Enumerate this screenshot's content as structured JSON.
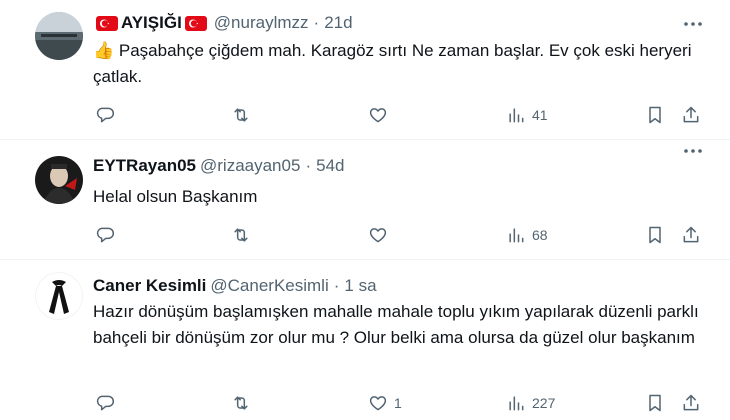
{
  "tweets": [
    {
      "display_name": "AYIŞIĞI",
      "handle": "@nuraylmzz",
      "separator": "·",
      "time": "21d",
      "text": "👍 Paşabahçe çiğdem mah. Karagöz sırtı  Ne zaman başlar. Ev çok eski heryeri çatlak.",
      "reply_count": "",
      "retweet_count": "",
      "like_count": "",
      "views": "41"
    },
    {
      "display_name": "EYTRayan05",
      "handle": "@rizaayan05",
      "separator": "·",
      "time": "54d",
      "text": "Helal olsun Başkanım",
      "reply_count": "",
      "retweet_count": "",
      "like_count": "",
      "views": "68"
    },
    {
      "display_name": "Caner Kesimli",
      "handle": "@CanerKesimli",
      "separator": "·",
      "time": "1 sa",
      "text": "Hazır dönüşüm başlamışken mahalle mahale toplu yıkım yapılarak düzenli parklı bahçeli bir dönüşüm zor olur mu ? Olur belki ama olursa da güzel olur başkanım",
      "reply_count": "",
      "retweet_count": "",
      "like_count": "1",
      "views": "227"
    }
  ],
  "icons": {
    "reply": "reply-icon",
    "retweet": "retweet-icon",
    "like": "heart-icon",
    "views": "views-icon",
    "bookmark": "bookmark-icon",
    "share": "share-icon",
    "more": "more-icon",
    "flag": "turkey-flag-icon"
  },
  "colors": {
    "muted": "#536471",
    "text": "#0f1419",
    "divider": "#eff3f4",
    "flag_red": "#e30a17"
  }
}
